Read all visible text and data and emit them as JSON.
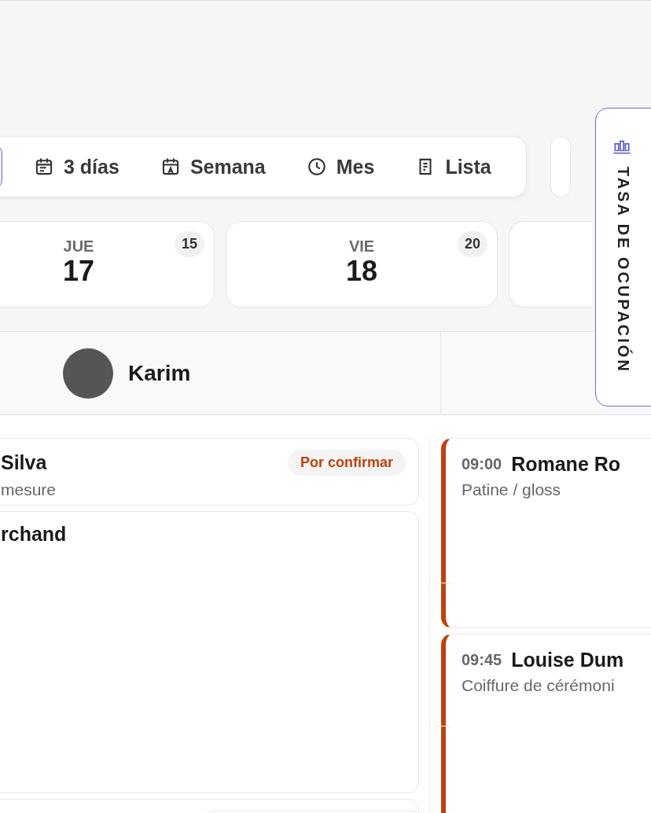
{
  "view_tabs": [
    {
      "kind": "days",
      "label": "3 días",
      "selected": false
    },
    {
      "kind": "week",
      "label": "Semana",
      "selected": false
    },
    {
      "kind": "month",
      "label": "Mes",
      "selected": false
    },
    {
      "kind": "list",
      "label": "Lista",
      "selected": false
    }
  ],
  "days": [
    {
      "weekday": "JUE",
      "day": "17",
      "count": "15"
    },
    {
      "weekday": "VIE",
      "day": "18",
      "count": "20"
    }
  ],
  "staff": [
    {
      "name": "Karim"
    }
  ],
  "columns": [
    {
      "appointments": [
        {
          "client": "Silva",
          "service": "mesure",
          "status": "Por confirmar"
        },
        {
          "client": "rchand"
        }
      ]
    },
    {
      "appointments": [
        {
          "time": "09:00",
          "client": "Romane Ro",
          "service": "Patine / gloss",
          "color": "#c2410c"
        },
        {
          "time": "09:45",
          "client": "Louise Dum",
          "service": "Coiffure de cérémoni",
          "color": "#c2410c"
        }
      ]
    }
  ],
  "side_panel": {
    "label": "TASA DE OCUPACIÓN"
  }
}
